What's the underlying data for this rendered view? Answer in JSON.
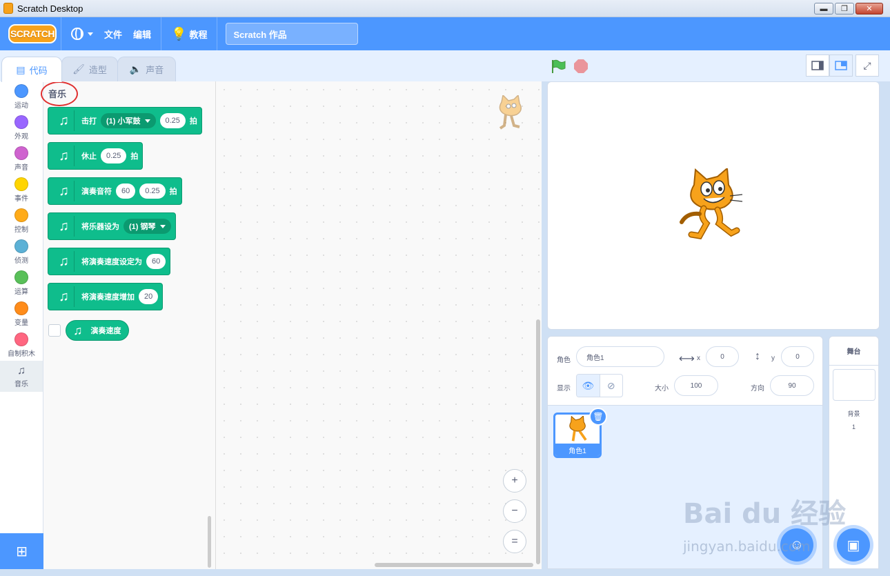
{
  "window": {
    "title": "Scratch Desktop",
    "minimize": "▬",
    "maximize": "❐",
    "close": "✕"
  },
  "menubar": {
    "logo": "SCRATCH",
    "file": "文件",
    "edit": "编辑",
    "tutorials": "教程",
    "project_title": "Scratch 作品"
  },
  "tabs": [
    {
      "label": "代码"
    },
    {
      "label": "造型"
    },
    {
      "label": "声音"
    }
  ],
  "categories": [
    {
      "label": "运动",
      "color": "#4c97ff"
    },
    {
      "label": "外观",
      "color": "#9966ff"
    },
    {
      "label": "声音",
      "color": "#cf63cf"
    },
    {
      "label": "事件",
      "color": "#ffd500"
    },
    {
      "label": "控制",
      "color": "#ffab19"
    },
    {
      "label": "侦测",
      "color": "#5cb1d6"
    },
    {
      "label": "运算",
      "color": "#59c059"
    },
    {
      "label": "变量",
      "color": "#ff8c1a"
    },
    {
      "label": "自制积木",
      "color": "#ff6680"
    },
    {
      "label": "音乐",
      "color": "#0fbd8c"
    }
  ],
  "palette": {
    "title": "音乐",
    "blocks": {
      "drum": {
        "label": "击打",
        "menu": "(1) 小军鼓",
        "beats": "0.25",
        "unit": "拍"
      },
      "rest": {
        "label": "休止",
        "beats": "0.25",
        "unit": "拍"
      },
      "note": {
        "label": "演奏音符",
        "note": "60",
        "beats": "0.25",
        "unit": "拍"
      },
      "instrument": {
        "label": "将乐器设为",
        "menu": "(1) 钢琴"
      },
      "set_tempo": {
        "label": "将演奏速度设定为",
        "value": "60"
      },
      "change_tempo": {
        "label": "将演奏速度增加",
        "value": "20"
      },
      "tempo_reporter": {
        "label": "演奏速度"
      }
    }
  },
  "zoom": {
    "in": "+",
    "out": "−",
    "reset": "="
  },
  "sprite_info": {
    "sprite_label": "角色",
    "sprite_name": "角色1",
    "x_label": "x",
    "x_value": "0",
    "y_label": "y",
    "y_value": "0",
    "show_label": "显示",
    "size_label": "大小",
    "size_value": "100",
    "direction_label": "方向",
    "direction_value": "90"
  },
  "sprites": [
    {
      "name": "角色1"
    }
  ],
  "stage_selector": {
    "header": "舞台",
    "backdrops_label": "背景",
    "backdrops_count": "1"
  },
  "watermark": {
    "brand": "Bai du 经验",
    "url": "jingyan.baidu.com"
  },
  "colors": {
    "accent": "#4c97ff",
    "music": "#0fbd8c"
  }
}
